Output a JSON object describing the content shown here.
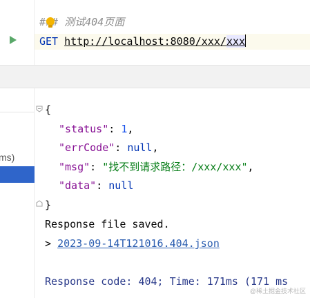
{
  "editor": {
    "comment_prefix": "###",
    "comment_text": " 测试404页面",
    "method": "GET",
    "url_main": "http://localhost:8080/xxx/",
    "url_last": "xxx"
  },
  "left_panel": {
    "partial_text": "ms)"
  },
  "response": {
    "open_brace": "{",
    "fields": [
      {
        "key": "\"status\"",
        "colon": ": ",
        "value": "1",
        "type": "num",
        "comma": ","
      },
      {
        "key": "\"errCode\"",
        "colon": ": ",
        "value": "null",
        "type": "nul",
        "comma": ","
      },
      {
        "key": "\"msg\"",
        "colon": ": ",
        "value": "\"找不到请求路径：/xxx/xxx\"",
        "type": "str",
        "comma": ","
      },
      {
        "key": "\"data\"",
        "colon": ": ",
        "value": "null",
        "type": "nul",
        "comma": ""
      }
    ],
    "close_brace": "}",
    "saved_text": "Response file saved.",
    "file_prefix": "> ",
    "file_link": "2023-09-14T121016.404.json",
    "code_line": "Response code: 404; Time: 171ms (171 ms"
  },
  "watermark": "@稀土掘金技术社区",
  "colors": {
    "run_icon": "#59a869",
    "selection": "#2f65ca",
    "keyword": "#0033b3",
    "json_key": "#871094",
    "json_string": "#067d17",
    "json_number": "#1750eb",
    "link": "#2a5db0"
  },
  "icons": [
    "run-icon",
    "lightbulb-icon",
    "fold-icon"
  ]
}
